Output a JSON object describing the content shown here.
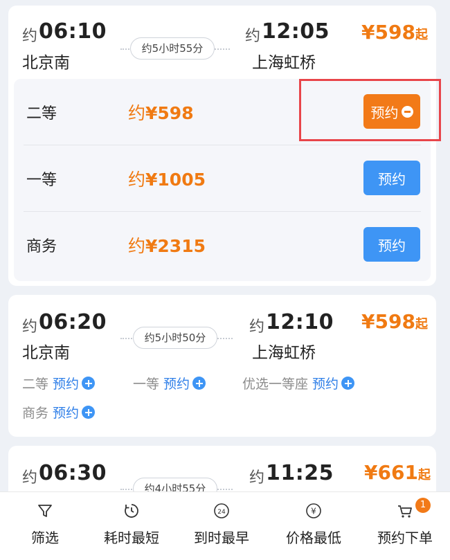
{
  "trains": [
    {
      "dep_approx": "约",
      "dep_time": "06:10",
      "dep_station": "北京南",
      "duration": "约5小时55分",
      "arr_approx": "约",
      "arr_time": "12:05",
      "arr_station": "上海虹桥",
      "from_price": "¥598",
      "from_suffix": "起",
      "seats": [
        {
          "name": "二等",
          "price_prefix": "约",
          "price": "¥598",
          "button": "预约",
          "selected": true
        },
        {
          "name": "一等",
          "price_prefix": "约",
          "price": "¥1005",
          "button": "预约",
          "selected": false
        },
        {
          "name": "商务",
          "price_prefix": "约",
          "price": "¥2315",
          "button": "预约",
          "selected": false
        }
      ]
    },
    {
      "dep_approx": "约",
      "dep_time": "06:20",
      "dep_station": "北京南",
      "duration": "约5小时50分",
      "arr_approx": "约",
      "arr_time": "12:10",
      "arr_station": "上海虹桥",
      "from_price": "¥598",
      "from_suffix": "起",
      "options": [
        {
          "name": "二等",
          "action": "预约"
        },
        {
          "name": "一等",
          "action": "预约"
        },
        {
          "name": "优选一等座",
          "action": "预约"
        },
        {
          "name": "商务",
          "action": "预约"
        }
      ]
    },
    {
      "dep_approx": "约",
      "dep_time": "06:30",
      "duration": "约4小时55分",
      "arr_approx": "约",
      "arr_time": "11:25",
      "from_price": "¥661",
      "from_suffix": "起"
    }
  ],
  "bottom_bar": {
    "tabs": [
      {
        "label": "筛选",
        "icon": "filter-icon"
      },
      {
        "label": "耗时最短",
        "icon": "timer-icon"
      },
      {
        "label": "到时最早",
        "icon": "24h-icon",
        "icon_text": "24"
      },
      {
        "label": "价格最低",
        "icon": "yen-icon",
        "icon_text": "¥"
      },
      {
        "label": "预约下单",
        "icon": "cart-icon",
        "badge": "1"
      }
    ]
  },
  "colors": {
    "accent_orange": "#f27a18",
    "accent_blue": "#3e95f5",
    "highlight_red": "#e8454a"
  }
}
